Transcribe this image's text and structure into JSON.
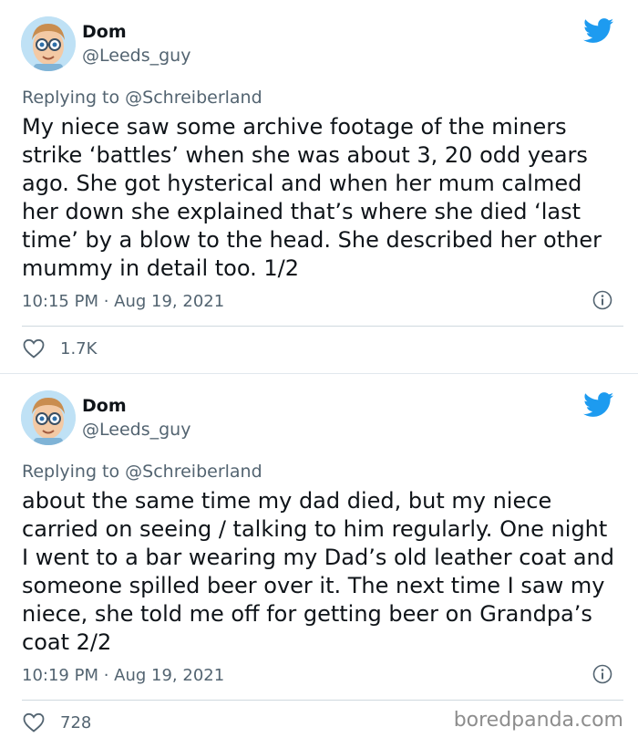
{
  "tweets": [
    {
      "name": "Dom",
      "handle": "@Leeds_guy",
      "replying_to": "Replying to @Schreiberland",
      "text": "My niece saw some archive footage of the miners strike ‘battles’ when she was about 3, 20 odd years ago.  She got hysterical and when her mum calmed her down she explained that’s where she died ‘last time’ by a blow to the head. She described her other mummy in detail too. 1/2",
      "timestamp": "10:15 PM · Aug 19, 2021",
      "likes": "1.7K"
    },
    {
      "name": "Dom",
      "handle": "@Leeds_guy",
      "replying_to": "Replying to @Schreiberland",
      "text": "about the same time my dad died, but my niece carried on seeing / talking to him regularly.  One night I went to a bar wearing my Dad’s old leather coat and someone spilled beer over it.  The next time I saw my niece, she told me off for getting beer on Grandpa’s coat 2/2",
      "timestamp": "10:19 PM · Aug 19, 2021",
      "likes": "728"
    }
  ],
  "watermark": "boredpanda.com",
  "icons": {
    "brand": "twitter-bird-icon",
    "info": "info-icon",
    "like": "heart-icon"
  },
  "colors": {
    "twitter_blue": "#1d9bf0",
    "secondary_text": "#536471",
    "divider": "#cfd9de"
  }
}
